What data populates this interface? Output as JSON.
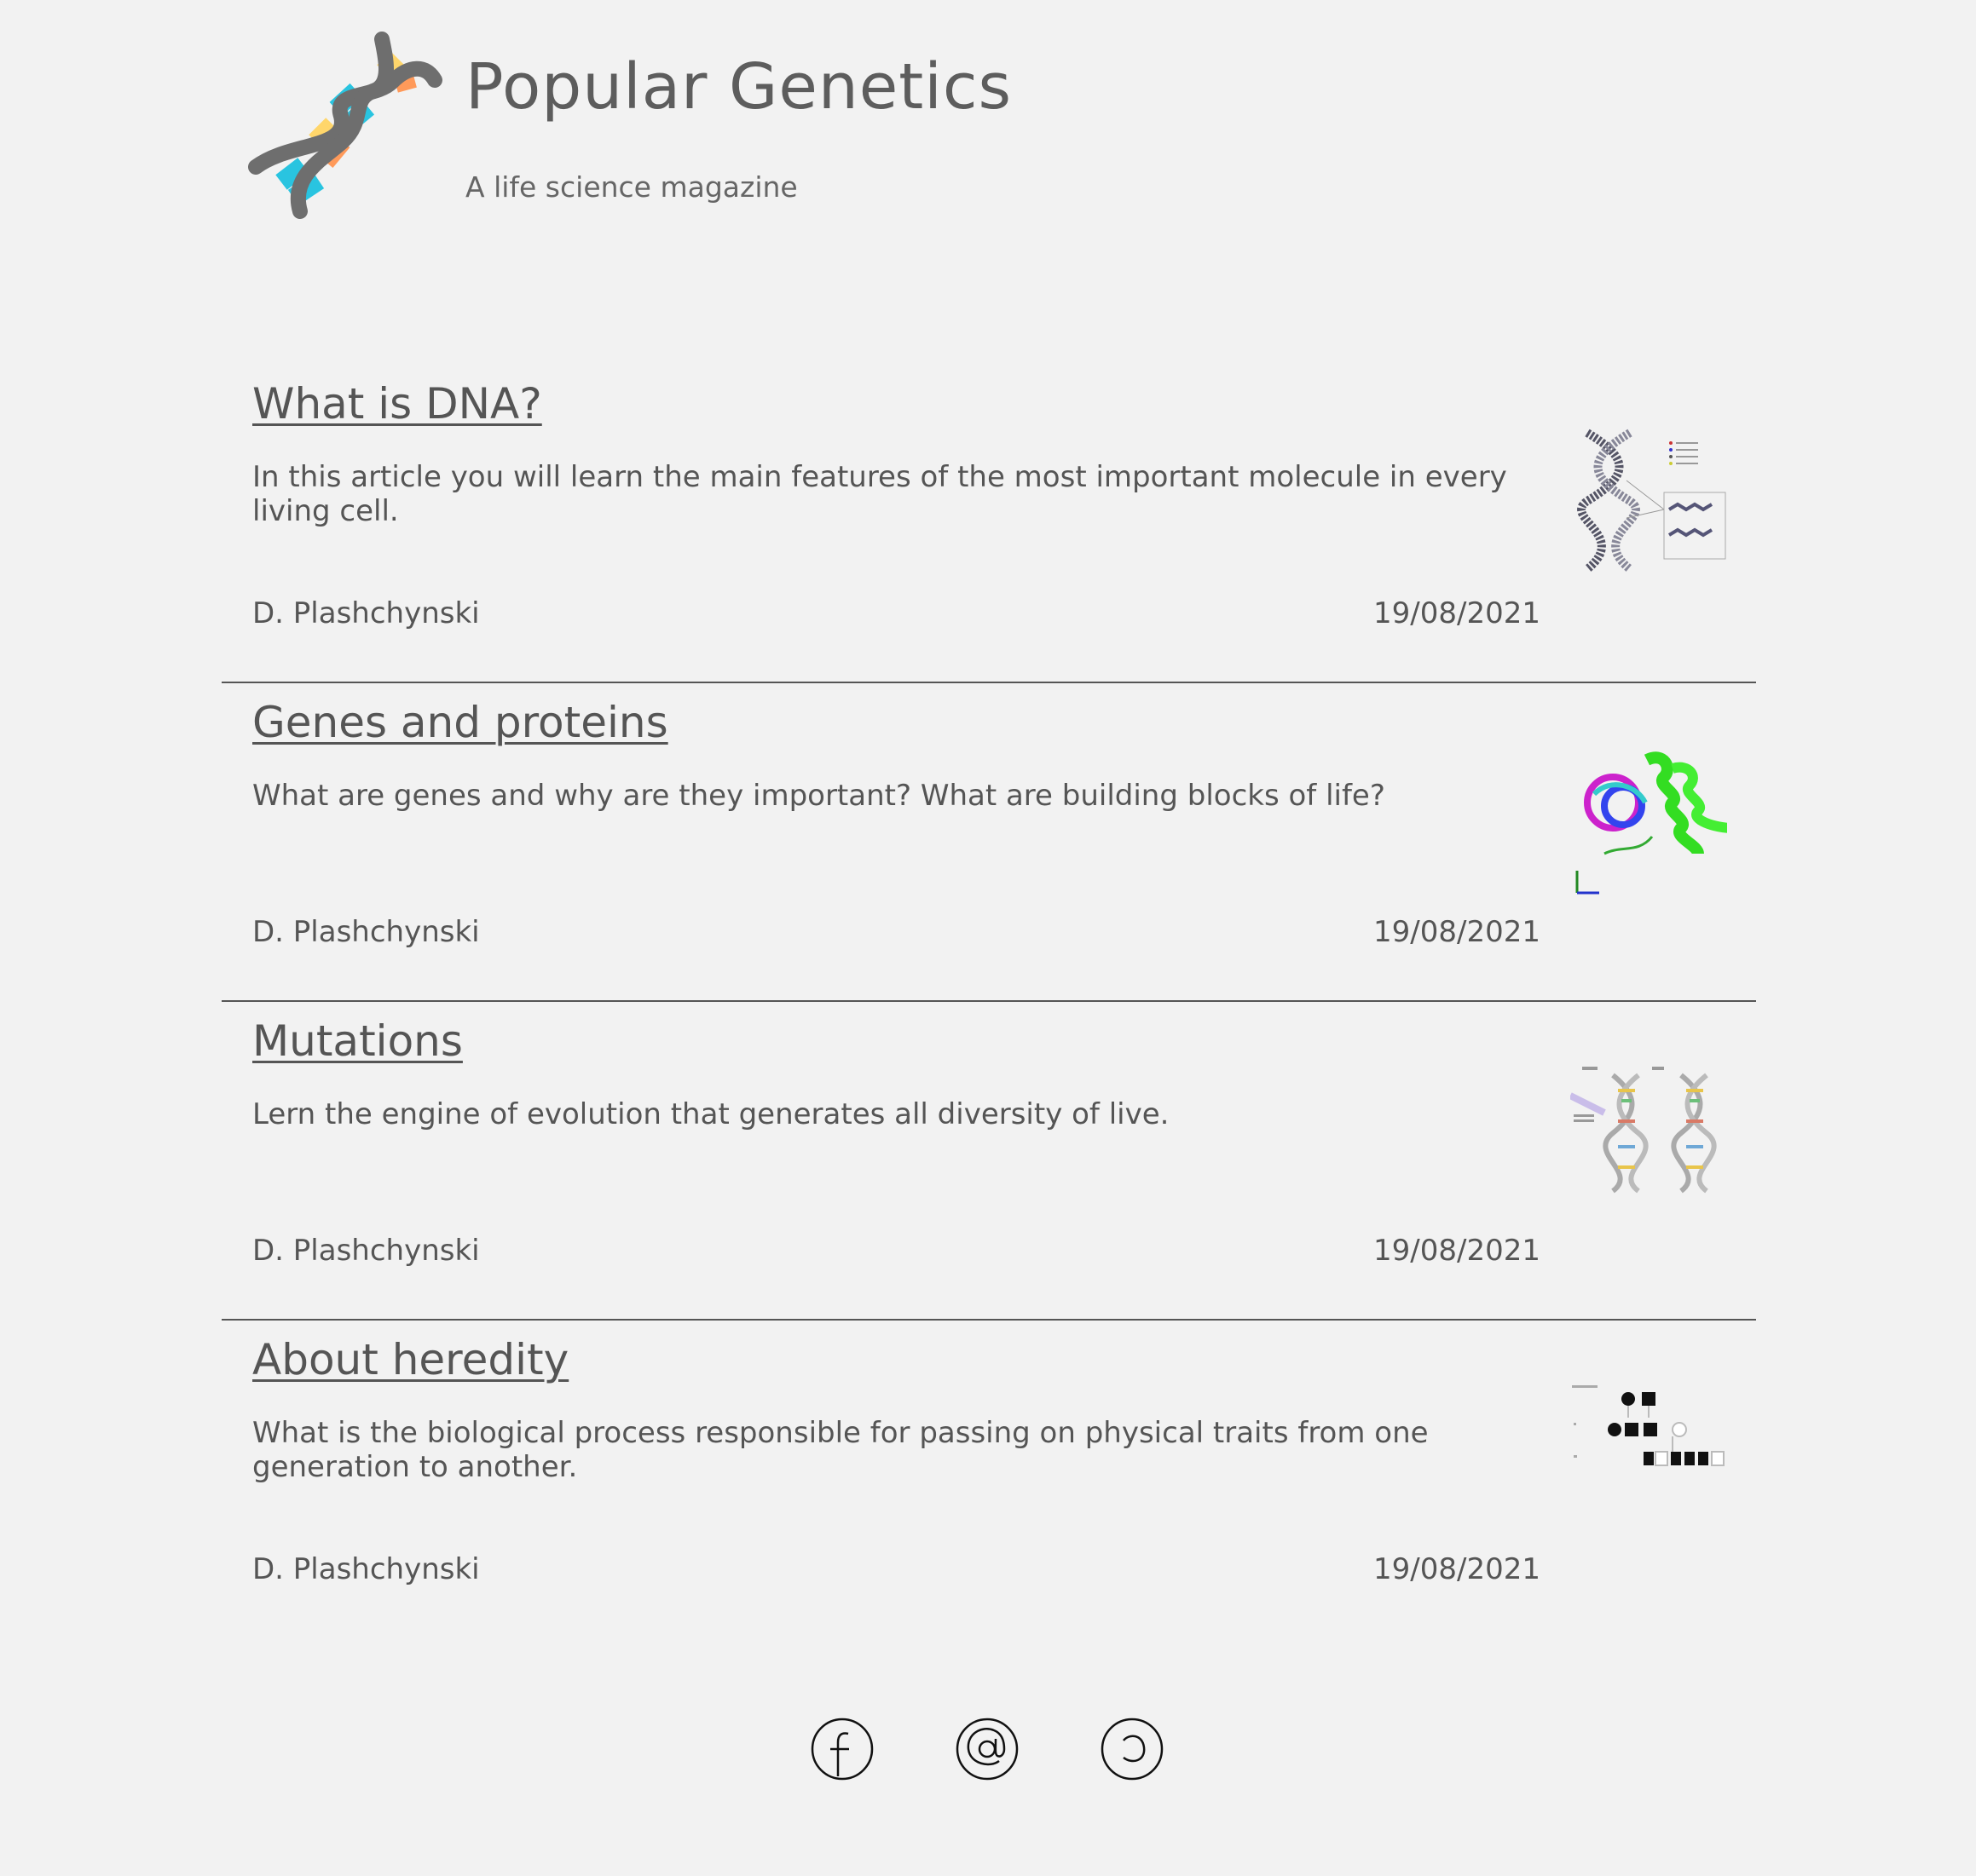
{
  "header": {
    "title": "Popular Genetics",
    "subtitle": "A life science magazine",
    "logo_icon": "dna-helix-icon"
  },
  "articles": [
    {
      "title": "What is DNA?",
      "excerpt": "In this article you will learn the main features of the most important molecule in every living cell.",
      "author": "D. Plashchynski",
      "date": "19/08/2021",
      "thumbnail_icon": "dna-structure-diagram"
    },
    {
      "title": "Genes and proteins",
      "excerpt": "What are genes and why are they important? What are building blocks of life?",
      "author": "D. Plashchynski",
      "date": "19/08/2021",
      "thumbnail_icon": "protein-structure-diagram"
    },
    {
      "title": "Mutations",
      "excerpt": "Lern the engine of evolution that generates all diversity of live.",
      "author": "D. Plashchynski",
      "date": "19/08/2021",
      "thumbnail_icon": "dna-mutation-diagram"
    },
    {
      "title": "About heredity",
      "excerpt": "What is the biological process responsible for passing on physical traits from one generation to another.",
      "author": "D. Plashchynski",
      "date": "19/08/2021",
      "thumbnail_icon": "pedigree-chart-diagram"
    }
  ],
  "footer": {
    "social_icons": [
      "facebook-icon",
      "email-icon",
      "copyleft-icon"
    ]
  },
  "colors": {
    "background": "#f2f2f2",
    "text": "#555555",
    "dna_blue": "#29c4e0",
    "dna_yellow": "#ffd66b",
    "dna_orange": "#ff9a5a",
    "dna_backbone": "#6e6e6e"
  }
}
